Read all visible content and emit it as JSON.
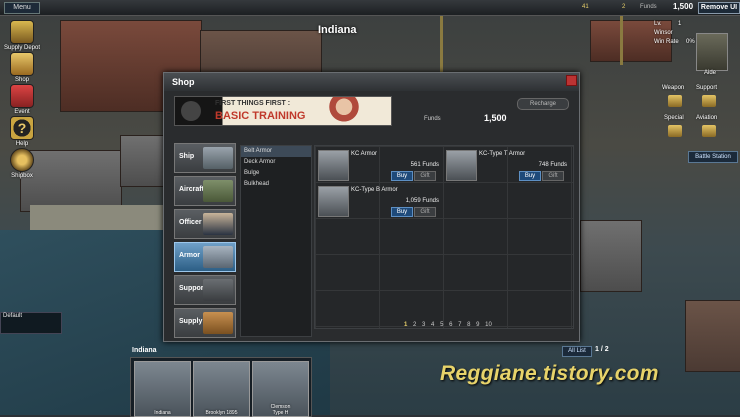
{
  "topbar": {
    "menu_label": "Menu",
    "resources": [
      "41",
      "2"
    ],
    "funds_label": "Funds",
    "funds_value": "1,500",
    "remove_ui_label": "Remove UI"
  },
  "ship_title": "Indiana",
  "left_menu": [
    {
      "label": "Supply Depot",
      "icon": "supply-depot-icon"
    },
    {
      "label": "Shop",
      "icon": "shop-bag-icon"
    },
    {
      "label": "Event",
      "icon": "gift-icon"
    },
    {
      "label": "Help",
      "icon": "help-icon"
    },
    {
      "label": "Shipbox",
      "icon": "ship-wheel-icon"
    }
  ],
  "right_panel": {
    "level_label": "Lv.",
    "level_value": "1",
    "name": "Winsor",
    "win_rate_label": "Win Rate",
    "win_rate_value": "0%",
    "aide_label": "Aide",
    "weapon_label": "Weapon",
    "support_label": "Support",
    "special_label": "Special",
    "aviation_label": "Aviation",
    "battle_station_label": "Battle Station"
  },
  "minimap_label": "Default",
  "shop": {
    "title": "Shop",
    "banner_line1": "FIRST THINGS FIRST :",
    "banner_line2": "BASIC TRAINING",
    "funds_label": "Funds",
    "funds_value": "1,500",
    "recharge_label": "Recharge",
    "categories": [
      {
        "label": "Ship",
        "icon": "battleship-icon",
        "active": false
      },
      {
        "label": "Aircraft",
        "icon": "aircraft-icon",
        "active": false
      },
      {
        "label": "Officer",
        "icon": "officer-icon",
        "active": false
      },
      {
        "label": "Armor",
        "icon": "armor-icon",
        "active": true
      },
      {
        "label": "Support",
        "icon": "support-icon",
        "active": false
      },
      {
        "label": "Supply",
        "icon": "supply-crate-icon",
        "active": false
      }
    ],
    "subcategories": [
      "Belt Armor",
      "Deck Armor",
      "Bulge",
      "Bulkhead"
    ],
    "items": [
      {
        "name": "KC Armor",
        "price": "561 Funds",
        "buy": "Buy",
        "gift": "Gift"
      },
      {
        "name": "KC-Type T Armor",
        "price": "748 Funds",
        "buy": "Buy",
        "gift": "Gift"
      },
      {
        "name": "KC-Type B Armor",
        "price": "1,059 Funds",
        "buy": "Buy",
        "gift": "Gift"
      }
    ],
    "pages": [
      "1",
      "2",
      "3",
      "4",
      "5",
      "6",
      "7",
      "8",
      "9",
      "10"
    ],
    "current_page": "1"
  },
  "fleet": {
    "label": "Indiana",
    "all_list_label": "All List",
    "page": "1 / 2",
    "cards": [
      {
        "name": "Indiana",
        "sub": ""
      },
      {
        "name": "Brooklyn 1895",
        "sub": ""
      },
      {
        "name": "Clemson",
        "sub": "Type H"
      }
    ]
  },
  "watermark": "Reggiane.tistory.com",
  "colors": {
    "accent": "#2c5e85",
    "funds": "#e8d06a",
    "watermark": "#e7d36a"
  }
}
